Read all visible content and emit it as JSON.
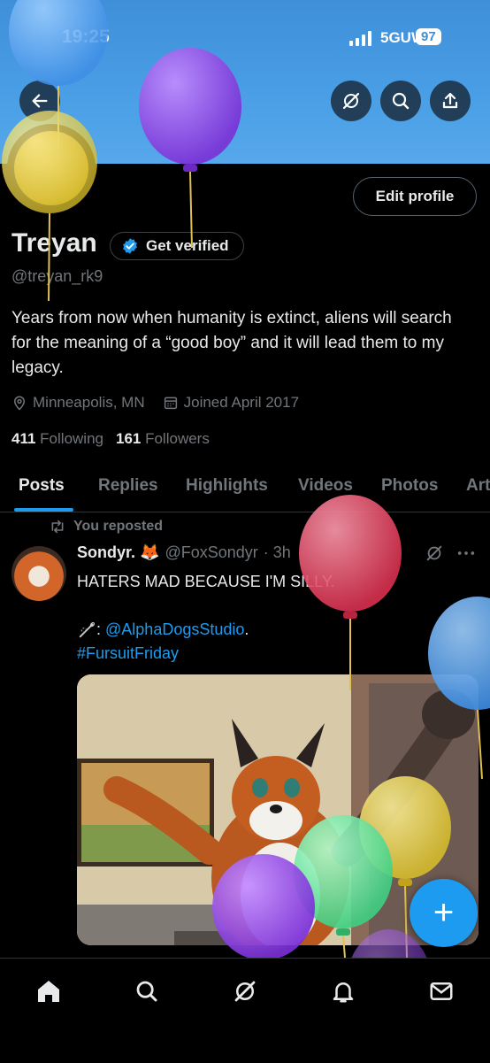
{
  "status_bar": {
    "time": "19:25",
    "network": "5GUW",
    "battery": "97"
  },
  "profile": {
    "edit_label": "Edit profile",
    "name": "Treyan",
    "verify_label": "Get verified",
    "handle": "@treyan_rk9",
    "bio": "Years from now when humanity is extinct, aliens will search for the meaning of a “good boy” and it will lead them to my legacy.",
    "location": "Minneapolis, MN",
    "joined": "Joined April 2017",
    "following_count": "411",
    "following_label": "Following",
    "followers_count": "161",
    "followers_label": "Followers"
  },
  "tabs": [
    "Posts",
    "Replies",
    "Highlights",
    "Videos",
    "Photos",
    "Art"
  ],
  "post": {
    "repost_label": "You reposted",
    "author_name": "Sondyr. 🦊",
    "author_handle": "@FoxSondyr",
    "time": "· 3h",
    "text_line1": "HATERS MAD BECAUSE I'M SILLY.",
    "credit_prefix": ": ",
    "credit_link": "@AlphaDogsStudio",
    "credit_suffix": ".",
    "hashtag": "#FursuitFriday"
  },
  "fab_label": "+",
  "icons": {
    "back": "back-arrow-icon",
    "grok": "grok-icon",
    "search": "search-icon",
    "share": "share-icon",
    "verified": "verified-badge-icon",
    "location": "location-pin-icon",
    "calendar": "calendar-icon",
    "repost": "repost-icon",
    "more": "more-icon",
    "needle": "needle-icon",
    "home": "home-icon",
    "bell": "notifications-icon",
    "mail": "messages-icon"
  },
  "colors": {
    "accent": "#1d9bf0",
    "banner": "#4a9fe6",
    "background": "#000000",
    "muted": "#71767b"
  }
}
